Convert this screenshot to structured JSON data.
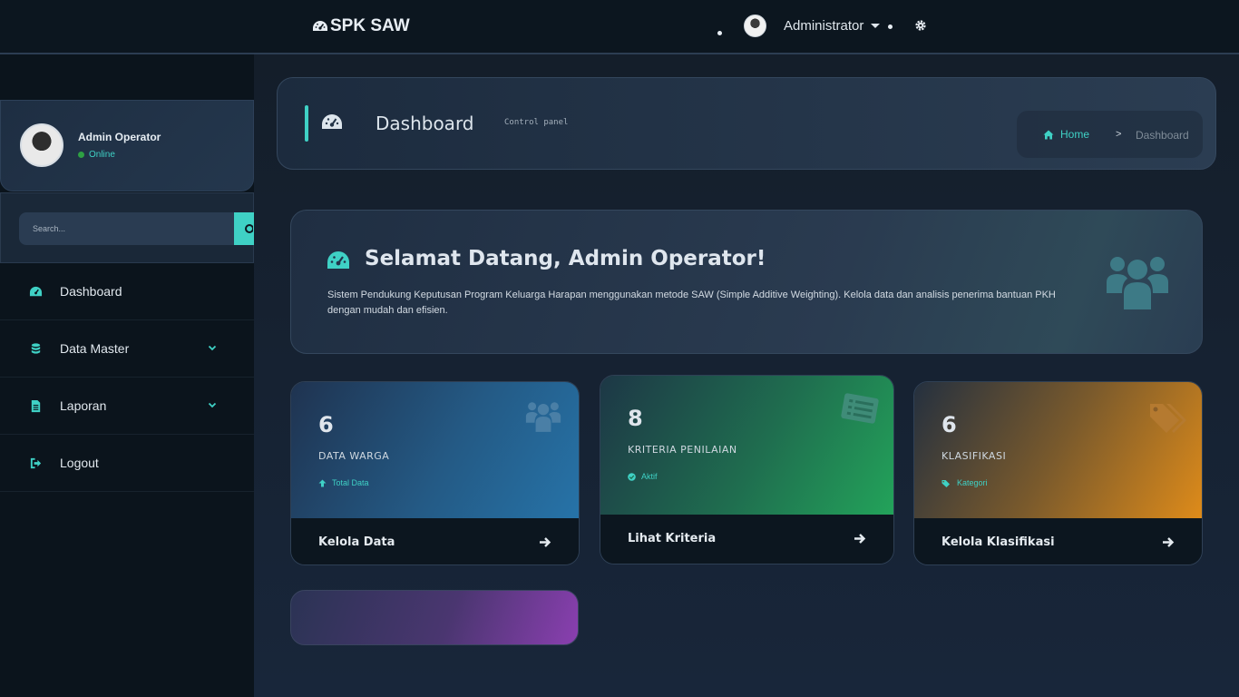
{
  "navbar": {
    "brand": "SPK SAW",
    "user_name": "Administrator"
  },
  "sidebar": {
    "profile": {
      "name": "Admin Operator",
      "status": "Online"
    },
    "search": {
      "placeholder": "Search..."
    },
    "items": [
      {
        "label": "Dashboard",
        "icon": "dashboard-icon"
      },
      {
        "label": "Data Master",
        "icon": "database-icon",
        "has_submenu": true
      },
      {
        "label": "Laporan",
        "icon": "file-icon",
        "has_submenu": true
      },
      {
        "label": "Logout",
        "icon": "logout-icon"
      }
    ]
  },
  "header": {
    "title": "Dashboard",
    "subtitle": "Control panel",
    "breadcrumb": {
      "home": "Home",
      "separator": ">",
      "current": "Dashboard"
    }
  },
  "welcome": {
    "title": "Selamat Datang, Admin Operator!",
    "text": "Sistem Pendukung Keputusan Program Keluarga Harapan menggunakan metode SAW (Simple Additive Weighting). Kelola data dan analisis penerima bantuan PKH dengan mudah dan efisien."
  },
  "stats": [
    {
      "value": "6",
      "label": "DATA WARGA",
      "meta": "Total Data",
      "action": "Kelola Data",
      "color": "#2673a8"
    },
    {
      "value": "8",
      "label": "KRITERIA PENILAIAN",
      "meta": "Aktif",
      "action": "Lihat Kriteria",
      "color": "#23a35a"
    },
    {
      "value": "6",
      "label": "KLASIFIKASI",
      "meta": "Kategori",
      "action": "Kelola Klasifikasi",
      "color": "#de8b1a"
    }
  ],
  "colors": {
    "accent": "#3fd1c5",
    "online": "#2ea043"
  }
}
